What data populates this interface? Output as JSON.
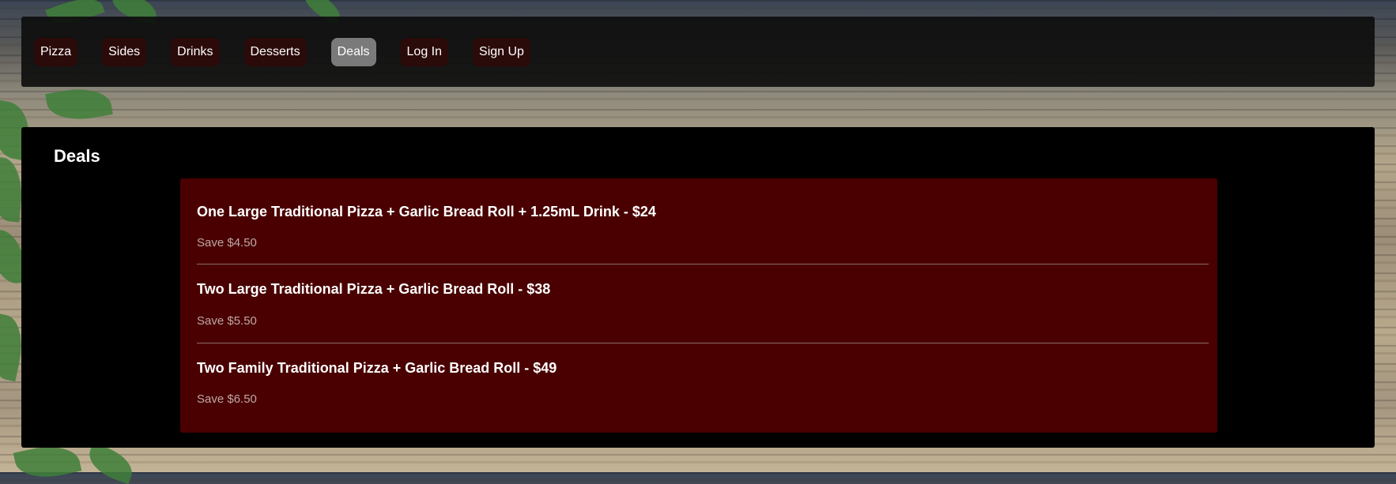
{
  "nav": {
    "items": [
      {
        "label": "Pizza"
      },
      {
        "label": "Sides"
      },
      {
        "label": "Drinks"
      },
      {
        "label": "Desserts"
      },
      {
        "label": "Deals",
        "active": true
      },
      {
        "label": "Log In"
      },
      {
        "label": "Sign Up"
      }
    ]
  },
  "main": {
    "title": "Deals",
    "deals": [
      {
        "title": "One Large Traditional Pizza + Garlic Bread Roll + 1.25mL Drink - $24",
        "save": "Save $4.50"
      },
      {
        "title": "Two Large Traditional Pizza + Garlic Bread Roll - $38",
        "save": "Save $5.50"
      },
      {
        "title": "Two Family Traditional Pizza + Garlic Bread Roll - $49",
        "save": "Save $6.50"
      }
    ]
  },
  "colors": {
    "nav_bg": "#0c0c0c",
    "nav_item_bg": "#2b0a0a",
    "nav_item_active_bg": "#7a7a7a",
    "panel_bg": "#000000",
    "deals_bg": "#4a0000",
    "save_text": "#bfa8a8"
  }
}
